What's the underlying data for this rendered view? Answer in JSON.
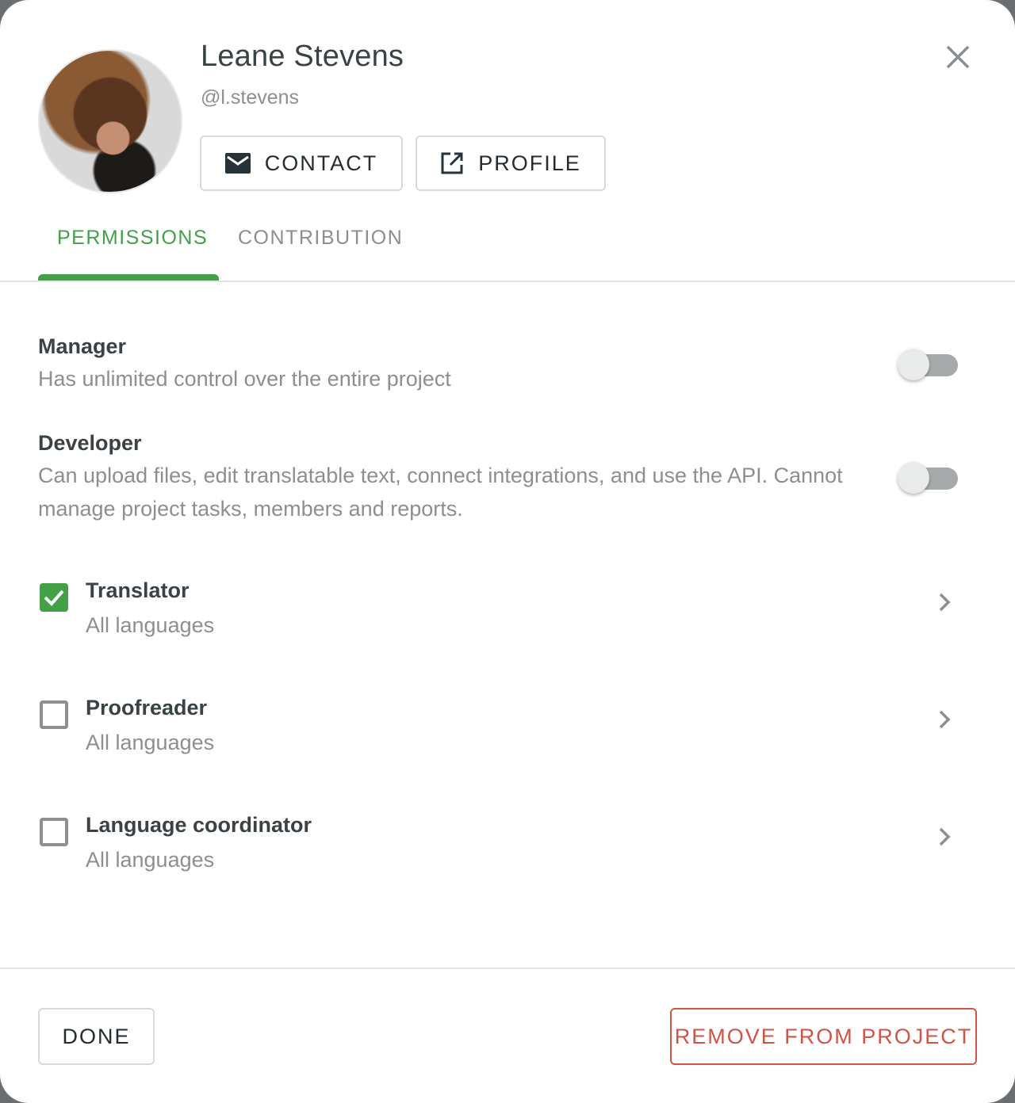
{
  "user": {
    "name": "Leane Stevens",
    "handle": "@l.stevens",
    "avatar_alt": "user-avatar-photo"
  },
  "header": {
    "contact_label": "CONTACT",
    "profile_label": "PROFILE",
    "contact_icon": "mail-icon",
    "profile_icon": "open-in-new-icon",
    "close_icon": "close-icon"
  },
  "tabs": [
    {
      "label": "PERMISSIONS",
      "active": true
    },
    {
      "label": "CONTRIBUTION",
      "active": false
    }
  ],
  "permissions": [
    {
      "title": "Manager",
      "description": "Has unlimited control over the entire project",
      "enabled": false
    },
    {
      "title": "Developer",
      "description": "Can upload files, edit translatable text, connect integrations, and use the API. Cannot manage project tasks, members and reports.",
      "enabled": false
    }
  ],
  "roles": [
    {
      "title": "Translator",
      "subtitle": "All languages",
      "checked": true
    },
    {
      "title": "Proofreader",
      "subtitle": "All languages",
      "checked": false
    },
    {
      "title": "Language coordinator",
      "subtitle": "All languages",
      "checked": false
    }
  ],
  "footer": {
    "done_label": "DONE",
    "remove_label": "REMOVE FROM PROJECT"
  },
  "colors": {
    "accent": "#43a047",
    "danger": "#cf5446",
    "muted_text": "#8b8f92",
    "primary_text": "#3a4246"
  }
}
